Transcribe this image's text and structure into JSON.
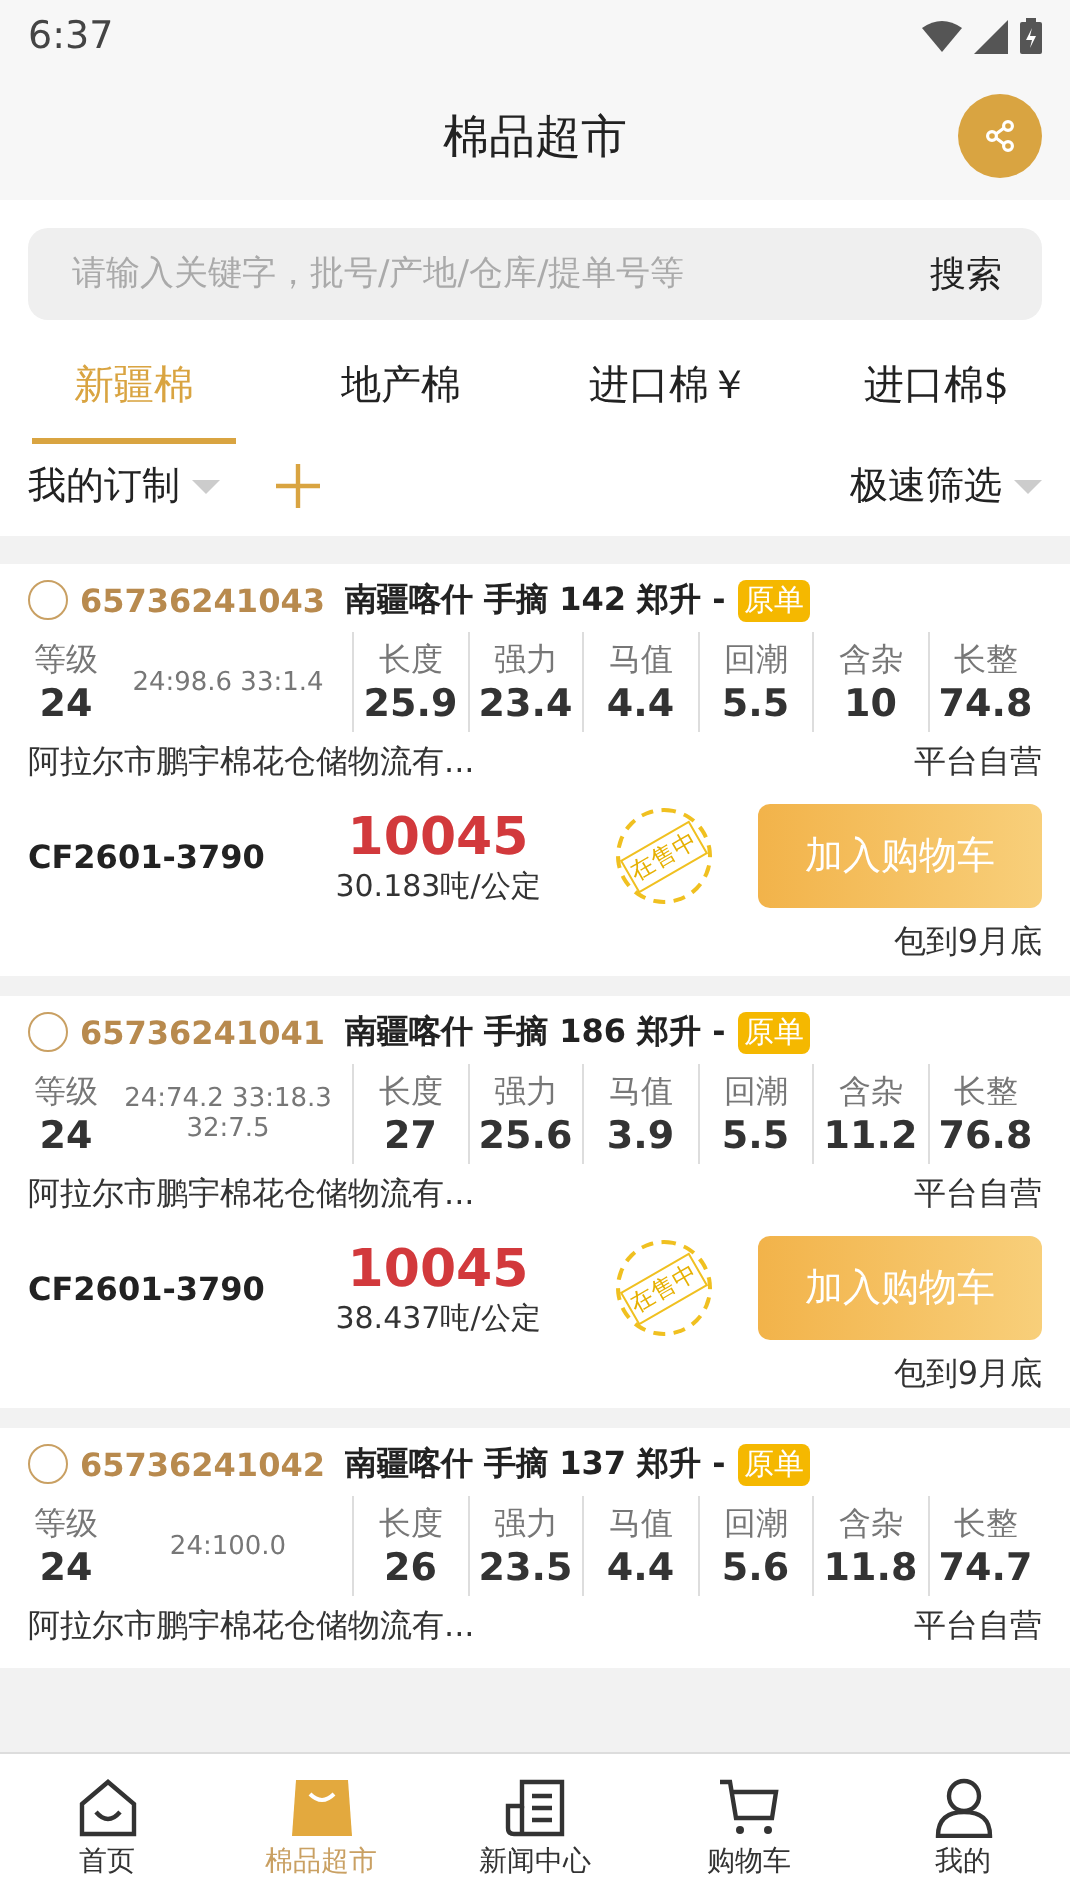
{
  "status_bar": {
    "time": "6:37"
  },
  "header": {
    "title": "棉品超市"
  },
  "search": {
    "placeholder": "请输入关键字，批号/产地/仓库/提单号等",
    "button": "搜索"
  },
  "tabs": [
    {
      "label": "新疆棉",
      "selected": true
    },
    {
      "label": "地产棉",
      "selected": false
    },
    {
      "label": "进口棉￥",
      "selected": false
    },
    {
      "label": "进口棉$",
      "selected": false
    }
  ],
  "filters": {
    "custom": "我的订制",
    "quick": "极速筛选"
  },
  "listings": [
    {
      "checked": false,
      "batch": "65736241043",
      "title": "南疆喀什 手摘 142 郑升 -",
      "tag": "原单",
      "grade_label": "等级",
      "grade": "24",
      "grade_notes": [
        "24:98.6 33:1.4"
      ],
      "specs": [
        {
          "label": "长度",
          "value": "25.9"
        },
        {
          "label": "强力",
          "value": "23.4"
        },
        {
          "label": "马值",
          "value": "4.4"
        },
        {
          "label": "回潮",
          "value": "5.5"
        },
        {
          "label": "含杂",
          "value": "10"
        },
        {
          "label": "长整",
          "value": "74.8"
        }
      ],
      "warehouse": "阿拉尔市鹏宇棉花仓储物流有...",
      "seller": "平台自营",
      "contract": "CF2601-3790",
      "price": "10045",
      "quantity": "30.183吨/公定",
      "stamp": "在售中",
      "button": "加入购物车",
      "delivery": "包到9月底"
    },
    {
      "checked": false,
      "batch": "65736241041",
      "title": "南疆喀什 手摘 186 郑升 -",
      "tag": "原单",
      "grade_label": "等级",
      "grade": "24",
      "grade_notes": [
        "24:74.2 33:18.3",
        "32:7.5"
      ],
      "specs": [
        {
          "label": "长度",
          "value": "27"
        },
        {
          "label": "强力",
          "value": "25.6"
        },
        {
          "label": "马值",
          "value": "3.9"
        },
        {
          "label": "回潮",
          "value": "5.5"
        },
        {
          "label": "含杂",
          "value": "11.2"
        },
        {
          "label": "长整",
          "value": "76.8"
        }
      ],
      "warehouse": "阿拉尔市鹏宇棉花仓储物流有...",
      "seller": "平台自营",
      "contract": "CF2601-3790",
      "price": "10045",
      "quantity": "38.437吨/公定",
      "stamp": "在售中",
      "button": "加入购物车",
      "delivery": "包到9月底"
    },
    {
      "checked": false,
      "batch": "65736241042",
      "title": "南疆喀什 手摘 137 郑升 -",
      "tag": "原单",
      "grade_label": "等级",
      "grade": "24",
      "grade_notes": [
        "24:100.0"
      ],
      "specs": [
        {
          "label": "长度",
          "value": "26"
        },
        {
          "label": "强力",
          "value": "23.5"
        },
        {
          "label": "马值",
          "value": "4.4"
        },
        {
          "label": "回潮",
          "value": "5.6"
        },
        {
          "label": "含杂",
          "value": "11.8"
        },
        {
          "label": "长整",
          "value": "74.7"
        }
      ],
      "warehouse": "阿拉尔市鹏宇棉花仓储物流有...",
      "seller": "平台自营"
    }
  ],
  "tab_bar": [
    {
      "kind": "home",
      "label": "首页",
      "selected": false
    },
    {
      "kind": "bag",
      "label": "棉品超市",
      "selected": true
    },
    {
      "kind": "news",
      "label": "新闻中心",
      "selected": false
    },
    {
      "kind": "cart",
      "label": "购物车",
      "selected": false
    },
    {
      "kind": "person",
      "label": "我的",
      "selected": false
    }
  ]
}
